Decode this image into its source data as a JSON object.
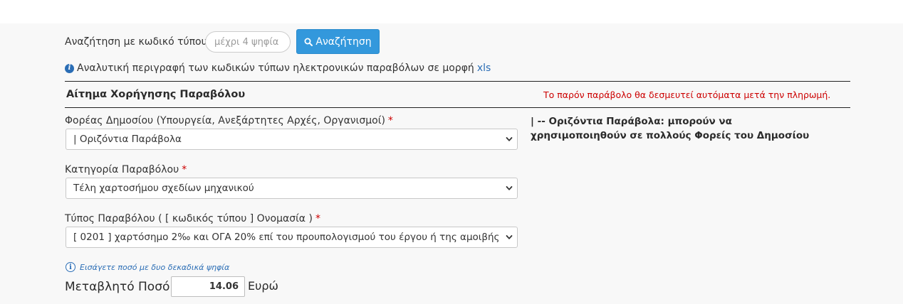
{
  "search": {
    "label": "Αναζήτηση με κωδικό τύπου",
    "placeholder": "μέχρι 4 ψηφία",
    "button_label": "Αναζήτηση",
    "button_color": "#3398dc"
  },
  "description": {
    "text": "Αναλυτική περιγραφή των κωδικών τύπων ηλεκτρονικών παραβόλων σε μορφή",
    "link": "xls"
  },
  "section": {
    "title": "Αίτημα Χορήγησης Παραβόλου",
    "note": "Το παρόν παράβολο θα δεσμευτεί αυτόματα μετά την πληρωμή."
  },
  "fields": {
    "agency": {
      "label": "Φορέας Δημοσίου (Υπουργεία, Ανεξάρτητες Αρχές, Οργανισμοί)",
      "required_mark": "*",
      "value": "| Οριζόντια Παράβολα"
    },
    "category": {
      "label": "Κατηγορία Παραβόλου",
      "required_mark": "*",
      "value": "Τέλη χαρτοσήμου σχεδίων μηχανικού"
    },
    "type": {
      "label": "Τύπος Παραβόλου ( [ κωδικός τύπου ] Ονομασία )",
      "required_mark": "*",
      "value": "[ 0201 ] χαρτόσημο 2‰ και ΟΓΑ 20% επί του προυπολογισμού του έργου ή της αμοιβής"
    }
  },
  "side_note": "| -- Οριζόντια Παράβολα: μπορούν να χρησιμοποιηθούν σε πολλούς Φορείς του Δημοσίου",
  "amount": {
    "hint": "Εισάγετε ποσό με δυο δεκαδικά ψηφία",
    "label": "Μεταβλητό Ποσό:",
    "value": "14.06",
    "unit": "Ευρώ"
  },
  "colors": {
    "required": "#cc0000",
    "link": "#2a6db5"
  }
}
